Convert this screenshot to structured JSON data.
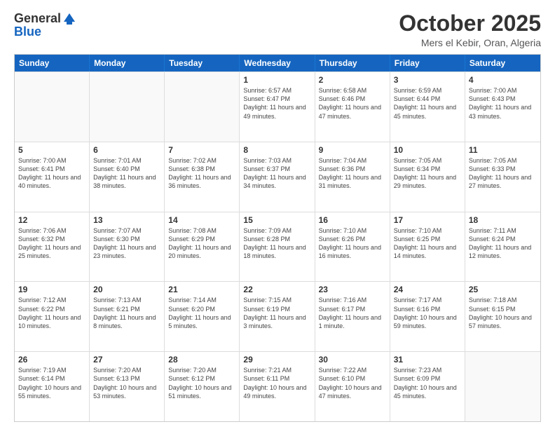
{
  "header": {
    "logo_line1": "General",
    "logo_line2": "Blue",
    "month": "October 2025",
    "location": "Mers el Kebir, Oran, Algeria"
  },
  "days_of_week": [
    "Sunday",
    "Monday",
    "Tuesday",
    "Wednesday",
    "Thursday",
    "Friday",
    "Saturday"
  ],
  "weeks": [
    [
      {
        "day": "",
        "sunrise": "",
        "sunset": "",
        "daylight": ""
      },
      {
        "day": "",
        "sunrise": "",
        "sunset": "",
        "daylight": ""
      },
      {
        "day": "",
        "sunrise": "",
        "sunset": "",
        "daylight": ""
      },
      {
        "day": "1",
        "sunrise": "Sunrise: 6:57 AM",
        "sunset": "Sunset: 6:47 PM",
        "daylight": "Daylight: 11 hours and 49 minutes."
      },
      {
        "day": "2",
        "sunrise": "Sunrise: 6:58 AM",
        "sunset": "Sunset: 6:46 PM",
        "daylight": "Daylight: 11 hours and 47 minutes."
      },
      {
        "day": "3",
        "sunrise": "Sunrise: 6:59 AM",
        "sunset": "Sunset: 6:44 PM",
        "daylight": "Daylight: 11 hours and 45 minutes."
      },
      {
        "day": "4",
        "sunrise": "Sunrise: 7:00 AM",
        "sunset": "Sunset: 6:43 PM",
        "daylight": "Daylight: 11 hours and 43 minutes."
      }
    ],
    [
      {
        "day": "5",
        "sunrise": "Sunrise: 7:00 AM",
        "sunset": "Sunset: 6:41 PM",
        "daylight": "Daylight: 11 hours and 40 minutes."
      },
      {
        "day": "6",
        "sunrise": "Sunrise: 7:01 AM",
        "sunset": "Sunset: 6:40 PM",
        "daylight": "Daylight: 11 hours and 38 minutes."
      },
      {
        "day": "7",
        "sunrise": "Sunrise: 7:02 AM",
        "sunset": "Sunset: 6:38 PM",
        "daylight": "Daylight: 11 hours and 36 minutes."
      },
      {
        "day": "8",
        "sunrise": "Sunrise: 7:03 AM",
        "sunset": "Sunset: 6:37 PM",
        "daylight": "Daylight: 11 hours and 34 minutes."
      },
      {
        "day": "9",
        "sunrise": "Sunrise: 7:04 AM",
        "sunset": "Sunset: 6:36 PM",
        "daylight": "Daylight: 11 hours and 31 minutes."
      },
      {
        "day": "10",
        "sunrise": "Sunrise: 7:05 AM",
        "sunset": "Sunset: 6:34 PM",
        "daylight": "Daylight: 11 hours and 29 minutes."
      },
      {
        "day": "11",
        "sunrise": "Sunrise: 7:05 AM",
        "sunset": "Sunset: 6:33 PM",
        "daylight": "Daylight: 11 hours and 27 minutes."
      }
    ],
    [
      {
        "day": "12",
        "sunrise": "Sunrise: 7:06 AM",
        "sunset": "Sunset: 6:32 PM",
        "daylight": "Daylight: 11 hours and 25 minutes."
      },
      {
        "day": "13",
        "sunrise": "Sunrise: 7:07 AM",
        "sunset": "Sunset: 6:30 PM",
        "daylight": "Daylight: 11 hours and 23 minutes."
      },
      {
        "day": "14",
        "sunrise": "Sunrise: 7:08 AM",
        "sunset": "Sunset: 6:29 PM",
        "daylight": "Daylight: 11 hours and 20 minutes."
      },
      {
        "day": "15",
        "sunrise": "Sunrise: 7:09 AM",
        "sunset": "Sunset: 6:28 PM",
        "daylight": "Daylight: 11 hours and 18 minutes."
      },
      {
        "day": "16",
        "sunrise": "Sunrise: 7:10 AM",
        "sunset": "Sunset: 6:26 PM",
        "daylight": "Daylight: 11 hours and 16 minutes."
      },
      {
        "day": "17",
        "sunrise": "Sunrise: 7:10 AM",
        "sunset": "Sunset: 6:25 PM",
        "daylight": "Daylight: 11 hours and 14 minutes."
      },
      {
        "day": "18",
        "sunrise": "Sunrise: 7:11 AM",
        "sunset": "Sunset: 6:24 PM",
        "daylight": "Daylight: 11 hours and 12 minutes."
      }
    ],
    [
      {
        "day": "19",
        "sunrise": "Sunrise: 7:12 AM",
        "sunset": "Sunset: 6:22 PM",
        "daylight": "Daylight: 11 hours and 10 minutes."
      },
      {
        "day": "20",
        "sunrise": "Sunrise: 7:13 AM",
        "sunset": "Sunset: 6:21 PM",
        "daylight": "Daylight: 11 hours and 8 minutes."
      },
      {
        "day": "21",
        "sunrise": "Sunrise: 7:14 AM",
        "sunset": "Sunset: 6:20 PM",
        "daylight": "Daylight: 11 hours and 5 minutes."
      },
      {
        "day": "22",
        "sunrise": "Sunrise: 7:15 AM",
        "sunset": "Sunset: 6:19 PM",
        "daylight": "Daylight: 11 hours and 3 minutes."
      },
      {
        "day": "23",
        "sunrise": "Sunrise: 7:16 AM",
        "sunset": "Sunset: 6:17 PM",
        "daylight": "Daylight: 11 hours and 1 minute."
      },
      {
        "day": "24",
        "sunrise": "Sunrise: 7:17 AM",
        "sunset": "Sunset: 6:16 PM",
        "daylight": "Daylight: 10 hours and 59 minutes."
      },
      {
        "day": "25",
        "sunrise": "Sunrise: 7:18 AM",
        "sunset": "Sunset: 6:15 PM",
        "daylight": "Daylight: 10 hours and 57 minutes."
      }
    ],
    [
      {
        "day": "26",
        "sunrise": "Sunrise: 7:19 AM",
        "sunset": "Sunset: 6:14 PM",
        "daylight": "Daylight: 10 hours and 55 minutes."
      },
      {
        "day": "27",
        "sunrise": "Sunrise: 7:20 AM",
        "sunset": "Sunset: 6:13 PM",
        "daylight": "Daylight: 10 hours and 53 minutes."
      },
      {
        "day": "28",
        "sunrise": "Sunrise: 7:20 AM",
        "sunset": "Sunset: 6:12 PM",
        "daylight": "Daylight: 10 hours and 51 minutes."
      },
      {
        "day": "29",
        "sunrise": "Sunrise: 7:21 AM",
        "sunset": "Sunset: 6:11 PM",
        "daylight": "Daylight: 10 hours and 49 minutes."
      },
      {
        "day": "30",
        "sunrise": "Sunrise: 7:22 AM",
        "sunset": "Sunset: 6:10 PM",
        "daylight": "Daylight: 10 hours and 47 minutes."
      },
      {
        "day": "31",
        "sunrise": "Sunrise: 7:23 AM",
        "sunset": "Sunset: 6:09 PM",
        "daylight": "Daylight: 10 hours and 45 minutes."
      },
      {
        "day": "",
        "sunrise": "",
        "sunset": "",
        "daylight": ""
      }
    ]
  ]
}
